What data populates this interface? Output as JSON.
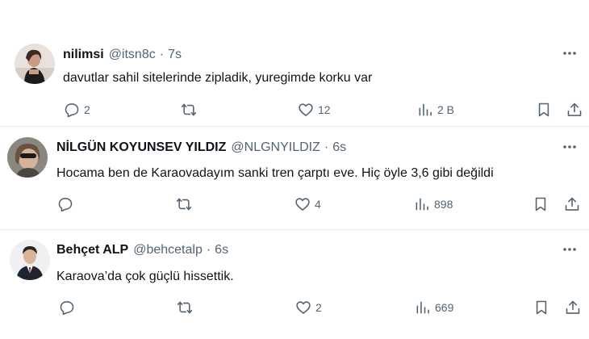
{
  "tweets": [
    {
      "name": "nilimsi",
      "handle": "@itsn8c",
      "dot": "·",
      "time": "7s",
      "text": "davutlar sahil sitelerinde zipladik, yuregimde korku var",
      "replies": "2",
      "retweets": "",
      "likes": "12",
      "views": "2 B"
    },
    {
      "name": "NİLGÜN KOYUNSEV YILDIZ",
      "handle": "@NLGNYILDIZ",
      "dot": "·",
      "time": "6s",
      "text": "Hocama ben de Karaovadayım sanki tren çarptı eve. Hiç öyle 3,6 gibi değildi",
      "replies": "",
      "retweets": "",
      "likes": "4",
      "views": "898"
    },
    {
      "name": "Behçet ALP",
      "handle": "@behcetalp",
      "dot": "·",
      "time": "6s",
      "text": "Karaova’da çok güçlü hissettik.",
      "replies": "",
      "retweets": "",
      "likes": "2",
      "views": "669"
    }
  ],
  "icons": {
    "reply": "reply-icon",
    "retweet": "retweet-icon",
    "like": "heart-icon",
    "views": "views-chart-icon",
    "bookmark": "bookmark-icon",
    "share": "share-icon",
    "more": "more-horizontal-icon"
  },
  "colors": {
    "text": "#0f1419",
    "secondary": "#536471",
    "divider": "#e6e9eb",
    "background": "#ffffff"
  }
}
